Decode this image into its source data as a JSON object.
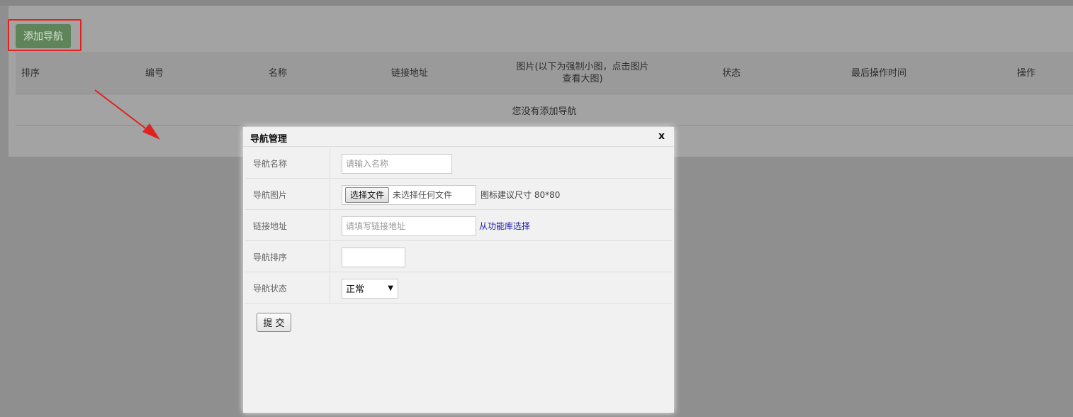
{
  "toolbar": {
    "add_nav_label": "添加导航"
  },
  "table": {
    "headers": [
      "排序",
      "编号",
      "名称",
      "链接地址",
      "图片(以下为强制小图，点击图片查看大图)",
      "状态",
      "最后操作时间",
      "操作"
    ],
    "empty_message": "您没有添加导航"
  },
  "modal": {
    "title": "导航管理",
    "close_label": "x",
    "fields": {
      "name": {
        "label": "导航名称",
        "placeholder": "请输入名称"
      },
      "image": {
        "label": "导航图片",
        "file_button": "选择文件",
        "file_status": "未选择任何文件",
        "hint": "图标建议尺寸 80*80"
      },
      "link": {
        "label": "链接地址",
        "placeholder": "请填写链接地址",
        "library_link": "从功能库选择"
      },
      "sort": {
        "label": "导航排序",
        "value": ""
      },
      "status": {
        "label": "导航状态",
        "selected": "正常"
      }
    },
    "submit_label": "提 交"
  },
  "colors": {
    "highlight": "#e0211f",
    "add_button": "#5f845a",
    "link": "#1a1aa6"
  }
}
